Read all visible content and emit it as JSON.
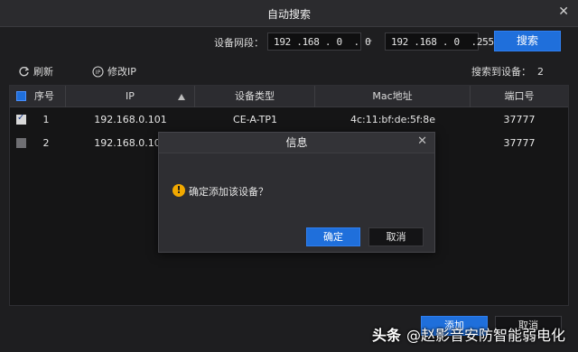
{
  "window": {
    "title": "自动搜索",
    "close_glyph": "✕"
  },
  "segment": {
    "label": "设备网段：",
    "from": "192 .168 . 0  . 0",
    "dash": "-",
    "to": "192 .168 . 0  .255",
    "search_label": "搜索"
  },
  "toolbar": {
    "refresh_label": "刷新",
    "modify_ip_label": "修改IP",
    "found_label": "搜索到设备：",
    "found_count": "2"
  },
  "table": {
    "columns": [
      "序号",
      "IP",
      "设备类型",
      "Mac地址",
      "端口号"
    ],
    "rows": [
      {
        "index": "1",
        "ip": "192.168.0.101",
        "type": "CE-A-TP1",
        "mac": "4c:11:bf:de:5f:8e",
        "port": "37777",
        "checked": true
      },
      {
        "index": "2",
        "ip": "192.168.0.109",
        "type": "",
        "mac": "",
        "port": "37777",
        "checked": false
      }
    ]
  },
  "dialog": {
    "title": "信息",
    "message": "确定添加该设备？",
    "ok_label": "确定",
    "cancel_label": "取消",
    "warn_glyph": "!"
  },
  "footer": {
    "add_label": "添加",
    "cancel_label": "取消"
  },
  "watermark": {
    "brand": "头条",
    "text": "@赵影音安防智能弱电化"
  },
  "colors": {
    "accent": "#1f6fdb",
    "background": "#1e1e20",
    "warning": "#f2a900"
  }
}
